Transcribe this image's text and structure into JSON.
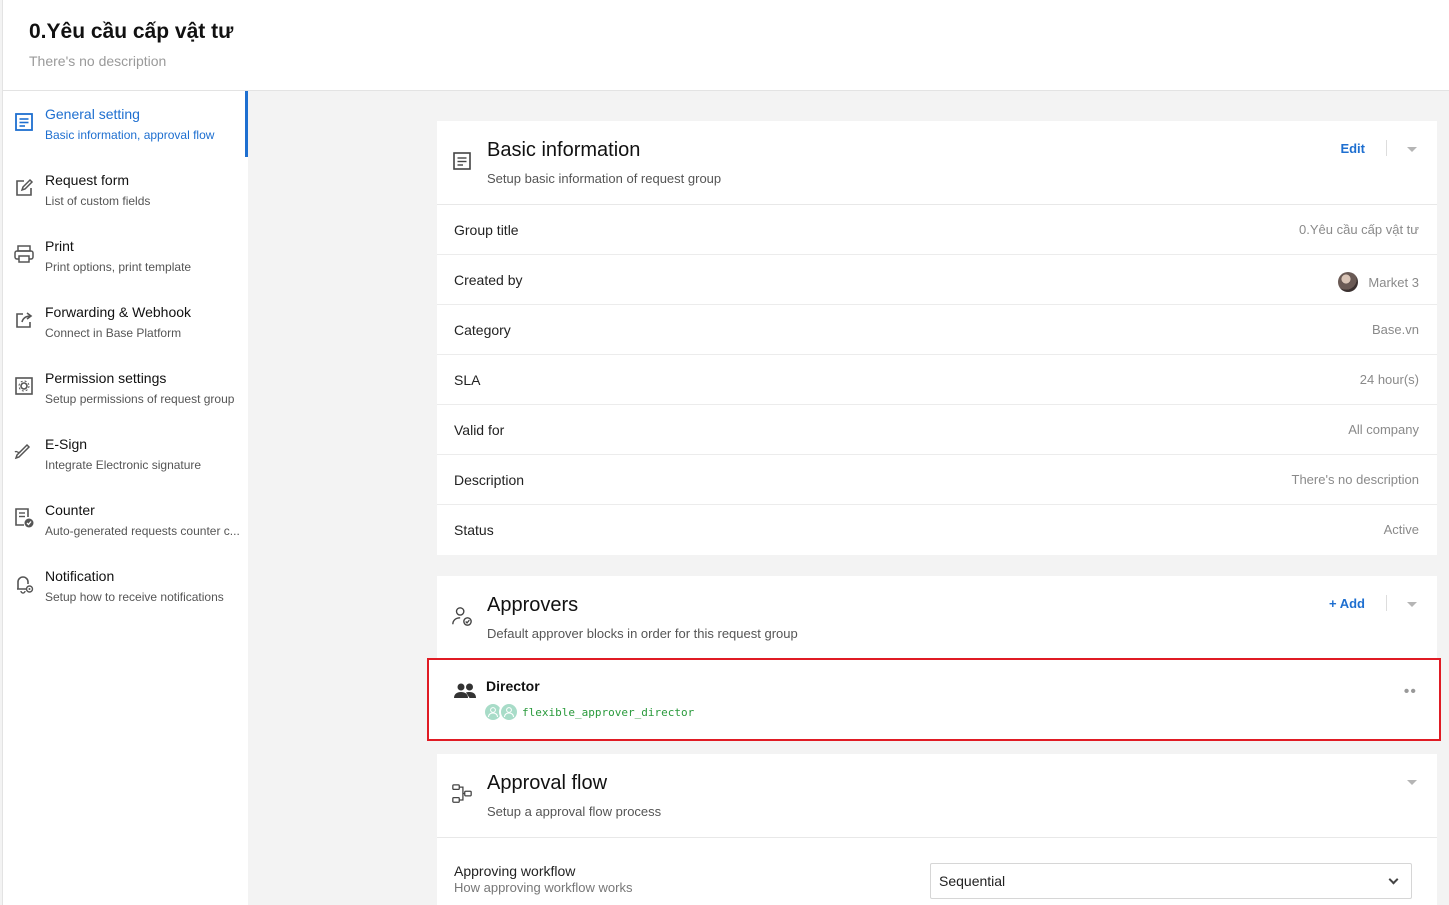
{
  "header": {
    "title": "0.Yêu cầu cấp vật tư",
    "description": "There's no description"
  },
  "sidebar": {
    "items": [
      {
        "label": "General setting",
        "sub": "Basic information, approval flow",
        "icon": "document-icon",
        "active": true
      },
      {
        "label": "Request form",
        "sub": "List of custom fields",
        "icon": "edit-icon"
      },
      {
        "label": "Print",
        "sub": "Print options, print template",
        "icon": "printer-icon"
      },
      {
        "label": "Forwarding & Webhook",
        "sub": "Connect in Base Platform",
        "icon": "share-icon"
      },
      {
        "label": "Permission settings",
        "sub": "Setup permissions of request group",
        "icon": "gear-box-icon"
      },
      {
        "label": "E-Sign",
        "sub": "Integrate Electronic signature",
        "icon": "signature-icon"
      },
      {
        "label": "Counter",
        "sub": "Auto-generated requests counter c...",
        "icon": "counter-icon"
      },
      {
        "label": "Notification",
        "sub": "Setup how to receive notifications",
        "icon": "bell-gear-icon"
      }
    ]
  },
  "basic_info": {
    "title": "Basic information",
    "subtitle": "Setup basic information of request group",
    "action": "Edit",
    "rows": [
      {
        "label": "Group title",
        "value": "0.Yêu cầu cấp vật tư"
      },
      {
        "label": "Created by",
        "value": "Market 3"
      },
      {
        "label": "Category",
        "value": "Base.vn"
      },
      {
        "label": "SLA",
        "value": "24 hour(s)"
      },
      {
        "label": "Valid for",
        "value": "All company"
      },
      {
        "label": "Description",
        "value": "There's no description"
      },
      {
        "label": "Status",
        "value": "Active"
      }
    ]
  },
  "approvers": {
    "title": "Approvers",
    "subtitle": "Default approver blocks in order for this request group",
    "action": "+ Add",
    "blocks": [
      {
        "title": "Director",
        "code": "flexible_approver_director"
      }
    ]
  },
  "approval_flow": {
    "title": "Approval flow",
    "subtitle": "Setup a approval flow process",
    "workflow_label": "Approving workflow",
    "workflow_sub": "How approving workflow works",
    "workflow_value": "Sequential"
  },
  "colors": {
    "accent": "#1e6fd0",
    "highlight_border": "#e01b24",
    "code_green": "#2a9a3c"
  }
}
